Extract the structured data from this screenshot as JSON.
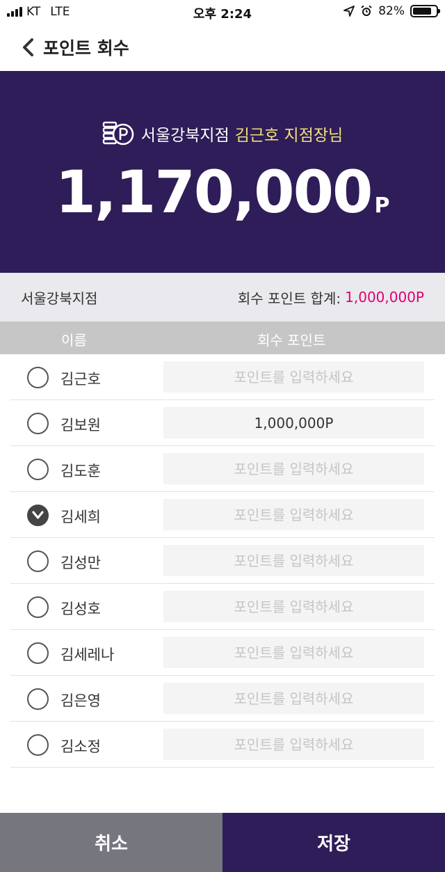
{
  "status_bar": {
    "carrier": "KT",
    "network": "LTE",
    "time": "오후 2:24",
    "battery": "82%",
    "battery_level": 0.82
  },
  "nav": {
    "back_icon": "chevron-left-icon",
    "title": "포인트 회수"
  },
  "hero": {
    "icon": "points-icon",
    "branch": "서울강북지점",
    "manager": "김근호 지점장님",
    "amount": "1,170,000",
    "unit": "P",
    "colors": {
      "background": "#2e1d58",
      "highlight": "#f3e07a"
    }
  },
  "summary": {
    "branch": "서울강북지점",
    "total_label": "회수 포인트 합계:",
    "total_value": "1,000,000P",
    "total_color": "#e0006e"
  },
  "table": {
    "col_name": "이름",
    "col_points": "회수 포인트",
    "placeholder": "포인트를 입력하세요",
    "rows": [
      {
        "name": "김근호",
        "value": "",
        "checked": false
      },
      {
        "name": "김보원",
        "value": "1,000,000P",
        "checked": false
      },
      {
        "name": "김도훈",
        "value": "",
        "checked": false
      },
      {
        "name": "김세희",
        "value": "",
        "checked": true
      },
      {
        "name": "김성만",
        "value": "",
        "checked": false
      },
      {
        "name": "김성호",
        "value": "",
        "checked": false
      },
      {
        "name": "김세레나",
        "value": "",
        "checked": false
      },
      {
        "name": "김은영",
        "value": "",
        "checked": false
      },
      {
        "name": "김소정",
        "value": "",
        "checked": false
      }
    ]
  },
  "buttons": {
    "cancel": "취소",
    "save": "저장"
  }
}
